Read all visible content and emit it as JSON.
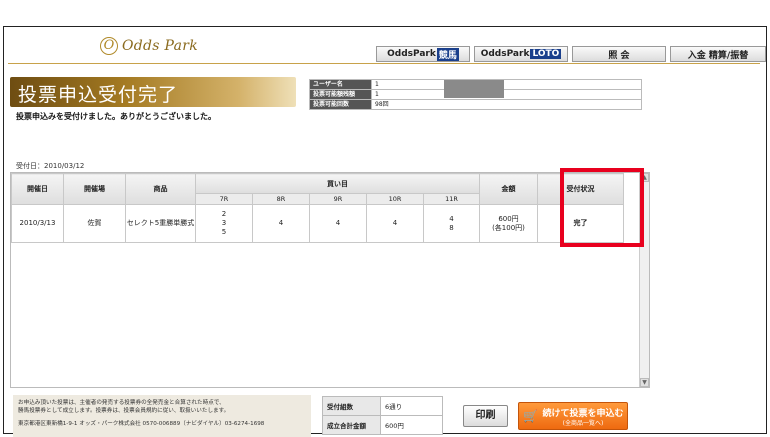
{
  "header": {
    "logo_mark": "O",
    "logo_text": "Odds Park",
    "nav": [
      {
        "label": "OddsPark",
        "highlight": "競馬"
      },
      {
        "label": "OddsPark",
        "highlight": "LOTO"
      },
      {
        "label": "照 会",
        "highlight": ""
      },
      {
        "label": "入金 精算/振替",
        "highlight": ""
      }
    ]
  },
  "title": "投票申込受付完了",
  "thanks_message": "投票申込みを受付けました。ありがとうございました。",
  "user_info": [
    {
      "label": "ユーザー名",
      "value": "1"
    },
    {
      "label": "投票可能額残額",
      "value": "1"
    },
    {
      "label": "投票可能回数",
      "value": "98回"
    }
  ],
  "accept_date": "受付日：2010/03/12",
  "table": {
    "headers": [
      "開催日",
      "開催場",
      "商品",
      "買い目",
      "金額",
      "受付状況"
    ],
    "race_headers": [
      "7R",
      "8R",
      "9R",
      "10R",
      "11R"
    ],
    "row": {
      "date": "2010/3/13",
      "venue": "佐賀",
      "product": "セレクト5重勝単勝式",
      "picks": [
        [
          "2",
          "3",
          "5"
        ],
        [
          "4"
        ],
        [
          "4"
        ],
        [
          "4"
        ],
        [
          "4",
          "8"
        ]
      ],
      "amount": "600円",
      "amount_each": "(各100円)",
      "status": "完了"
    }
  },
  "footer": {
    "notice_line1": "お申込み頂いた投票は、主催者の発売する投票券の全発売金と合算された時点で、",
    "notice_line2": "勝馬投票券として成立します。投票券は、投票会員規約に従い、取扱いいたします。",
    "address": "東京都港区東新橋1-9-1 オッズ・パーク株式会社 0570-006889（ナビダイヤル）03-6274-1698",
    "summary": [
      {
        "label": "受付組数",
        "value": "6通り"
      },
      {
        "label": "成立合計金額",
        "value": "600円"
      }
    ],
    "print_label": "印刷",
    "continue_label": "続けて投票を申込む",
    "continue_sub": "(全商品一覧へ)"
  },
  "colors": {
    "accent_gold": "#a47a22",
    "status_green": "#2e8b2e",
    "highlight_red": "#e8001e",
    "button_orange": "#ee6a10"
  }
}
